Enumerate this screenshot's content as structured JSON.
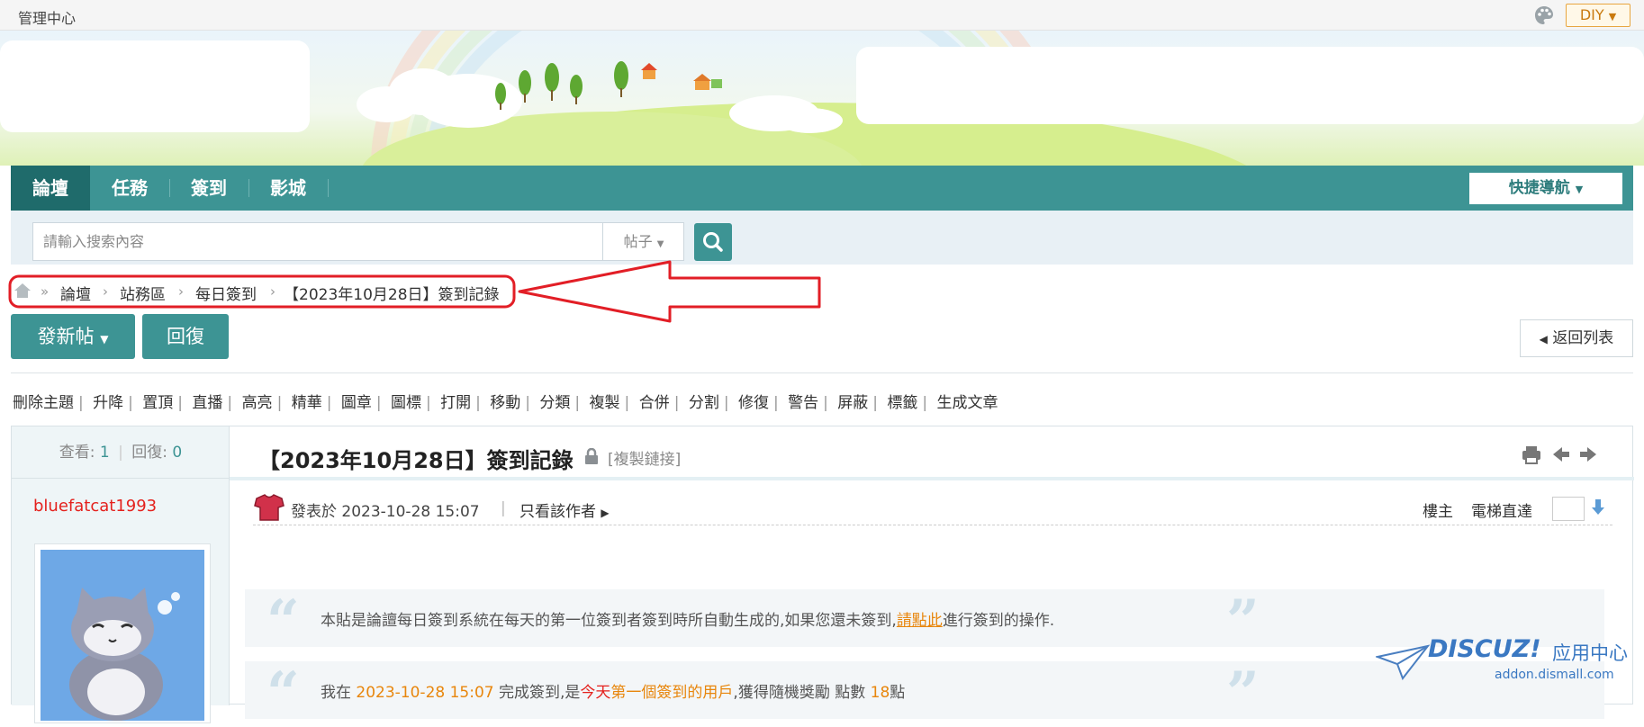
{
  "topbar": {
    "admin": "管理中心",
    "diy": "DIY"
  },
  "nav": {
    "items": [
      {
        "label": "論壇"
      },
      {
        "label": "任務"
      },
      {
        "label": "簽到"
      },
      {
        "label": "影城"
      }
    ],
    "quick_nav": "快捷導航"
  },
  "search": {
    "placeholder": "請輸入搜索內容",
    "type": "帖子"
  },
  "breadcrumb": [
    "論壇",
    "站務區",
    "每日簽到",
    "【2023年10月28日】簽到記錄"
  ],
  "actions": {
    "new_post": "發新帖",
    "reply": "回復",
    "back_list": "返回列表"
  },
  "mod_actions": [
    "刪除主題",
    "升降",
    "置頂",
    "直播",
    "高亮",
    "精華",
    "圖章",
    "圖標",
    "打開",
    "移動",
    "分類",
    "複製",
    "合併",
    "分割",
    "修復",
    "警告",
    "屏蔽",
    "標籤",
    "生成文章"
  ],
  "post": {
    "stats": {
      "views_label": "查看:",
      "views": "1",
      "replies_label": "回復:",
      "replies": "0"
    },
    "username": "bluefatcat1993",
    "title": "【2023年10月28日】簽到記錄",
    "copy_link": "[複製鏈接]",
    "posted_at": "發表於 2023-10-28 15:07",
    "only_author": "只看該作者",
    "floor": "樓主",
    "elevator": "電梯直達",
    "quote1": {
      "pre": "本貼是論譠每日簽到系統在每天的第一位簽到者簽到時所自動生成的,如果您還未簽到,",
      "link": "請點此",
      "post": "進行簽到的操作."
    },
    "quote2": {
      "a": "我在",
      "time": "2023-10-28 15:07",
      "b": "完成簽到,是",
      "today": "今天",
      "first": "第一個簽到的用戶",
      "c": ",獲得隨機獎勵 點數",
      "points": "18",
      "unit": "點"
    }
  },
  "watermark": {
    "brand": "DISCUZ!",
    "brand_cn": "应用中心",
    "site": "addon.dismall.com"
  },
  "colors": {
    "nav": "#3d9494",
    "nav_active": "#1f6b6b",
    "username": "#e4211d",
    "accent": "#e8860c"
  }
}
